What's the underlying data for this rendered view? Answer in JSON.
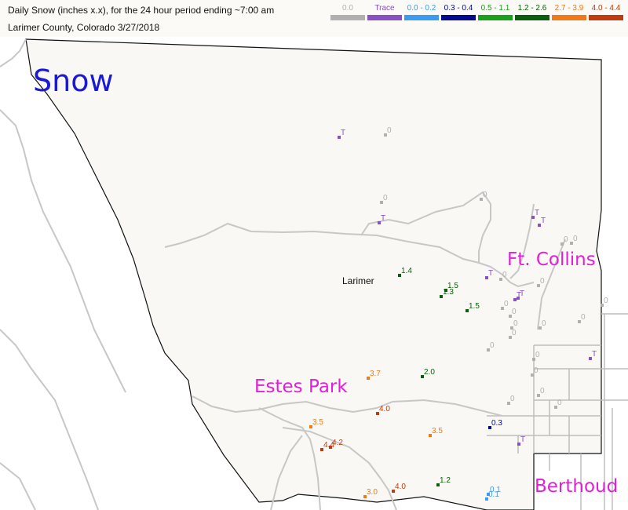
{
  "header": {
    "title_line": "Daily Snow (inches  x.x),  for the 24 hour period ending ~7:00 am",
    "subtitle_line": "Larimer County, Colorado  3/27/2018"
  },
  "legend": [
    {
      "label": "0.0",
      "color": "#b0b0b0"
    },
    {
      "label": "Trace",
      "color": "#8a4fc4"
    },
    {
      "label": "0.0 - 0.2",
      "color": "#3a9cf0"
    },
    {
      "label": "0.3 - 0.4",
      "color": "#000a8c"
    },
    {
      "label": "0.5 - 1.1",
      "color": "#1aa01a"
    },
    {
      "label": "1.2 - 2.6",
      "color": "#0b5e0b"
    },
    {
      "label": "2.7 - 3.9",
      "color": "#f07a1a"
    },
    {
      "label": "4.0 - 4.4",
      "color": "#c03c10"
    }
  ],
  "map_labels": {
    "snow": "Snow",
    "county": "Larimer",
    "ft_collins": "Ft. Collins",
    "estes_park": "Estes Park",
    "berthoud": "Berthoud"
  },
  "observations": [
    {
      "label": "T",
      "category": "trace"
    },
    {
      "label": "0",
      "category": "zero"
    },
    {
      "label": "0",
      "category": "zero"
    },
    {
      "label": "T",
      "category": "trace"
    },
    {
      "label": "0",
      "category": "zero"
    },
    {
      "label": "T",
      "category": "trace"
    },
    {
      "label": "T",
      "category": "trace"
    },
    {
      "label": "0",
      "category": "zero"
    },
    {
      "label": "1.4",
      "category": "1.2-2.6"
    },
    {
      "label": "1.5",
      "category": "1.2-2.6"
    },
    {
      "label": "1.3",
      "category": "1.2-2.6"
    },
    {
      "label": "1.5",
      "category": "1.2-2.6"
    },
    {
      "label": "T",
      "category": "trace"
    },
    {
      "label": "0",
      "category": "zero"
    },
    {
      "label": "T",
      "category": "trace"
    },
    {
      "label": "0",
      "category": "zero"
    },
    {
      "label": "0",
      "category": "zero"
    },
    {
      "label": "0",
      "category": "zero"
    },
    {
      "label": "0",
      "category": "zero"
    },
    {
      "label": "0",
      "category": "zero"
    },
    {
      "label": "0",
      "category": "zero"
    },
    {
      "label": "0",
      "category": "zero"
    },
    {
      "label": "0",
      "category": "zero"
    },
    {
      "label": "0",
      "category": "zero"
    },
    {
      "label": "T",
      "category": "trace"
    },
    {
      "label": "0",
      "category": "zero"
    },
    {
      "label": "0",
      "category": "zero"
    },
    {
      "label": "T",
      "category": "trace"
    },
    {
      "label": "0",
      "category": "zero"
    },
    {
      "label": "0",
      "category": "zero"
    },
    {
      "label": "0",
      "category": "zero"
    },
    {
      "label": "3.7",
      "category": "2.7-3.9"
    },
    {
      "label": "2.0",
      "category": "1.2-2.6"
    },
    {
      "label": "4.0",
      "category": "4.0-4.4"
    },
    {
      "label": "3.5",
      "category": "2.7-3.9"
    },
    {
      "label": "3.5",
      "category": "2.7-3.9"
    },
    {
      "label": "0.3",
      "category": "0.3-0.4"
    },
    {
      "label": "T",
      "category": "trace"
    },
    {
      "label": "4.4",
      "category": "4.0-4.4"
    },
    {
      "label": "4.2",
      "category": "4.0-4.4"
    },
    {
      "label": "3.0",
      "category": "2.7-3.9"
    },
    {
      "label": "4.0",
      "category": "4.0-4.4"
    },
    {
      "label": "1.2",
      "category": "1.2-2.6"
    },
    {
      "label": "0.1",
      "category": "0.0-0.2"
    },
    {
      "label": "0.1",
      "category": "0.0-0.2"
    },
    {
      "label": "0",
      "category": "zero"
    }
  ]
}
